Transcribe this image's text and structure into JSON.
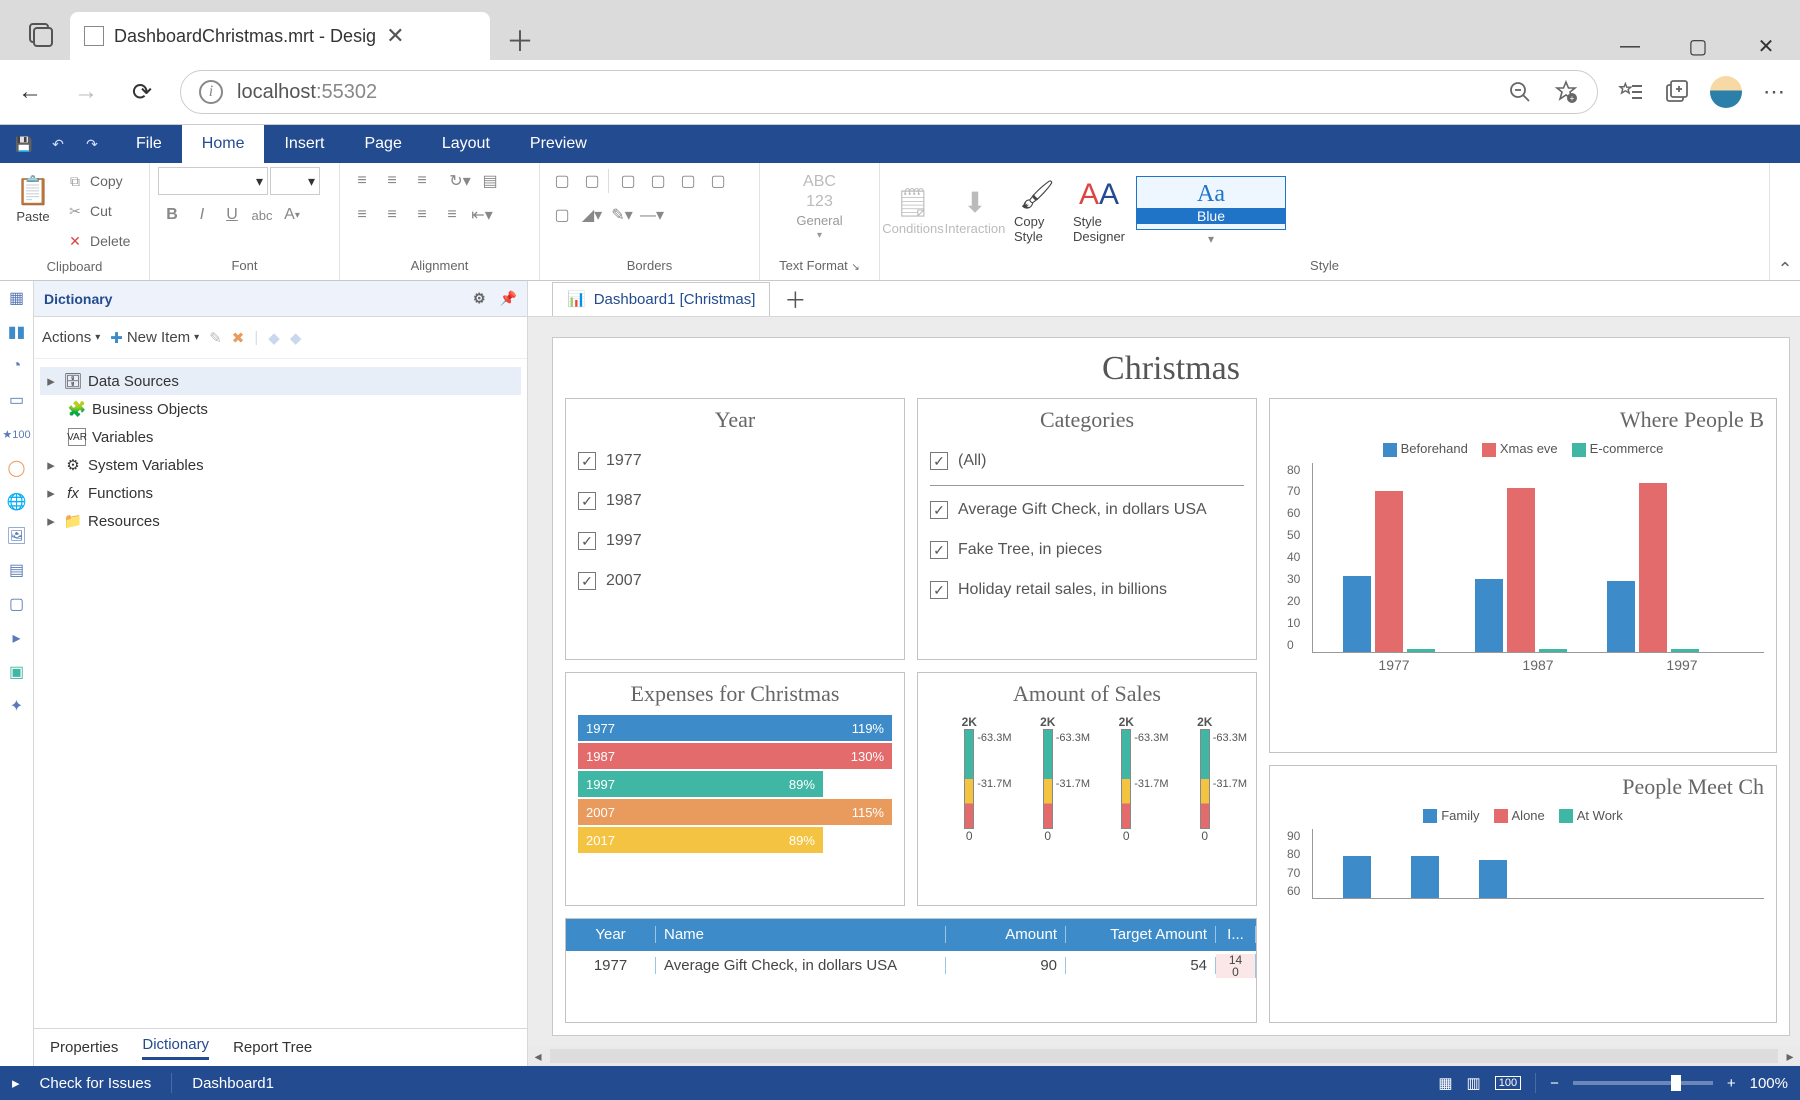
{
  "browser": {
    "tab_title": "DashboardChristmas.mrt - Desig",
    "host": "localhost",
    "port": ":55302"
  },
  "ribbon": {
    "tabs": [
      "File",
      "Home",
      "Insert",
      "Page",
      "Layout",
      "Preview"
    ],
    "active_tab": "Home",
    "clipboard": {
      "paste": "Paste",
      "copy": "Copy",
      "cut": "Cut",
      "delete": "Delete",
      "group": "Clipboard"
    },
    "font": {
      "group": "Font"
    },
    "alignment": {
      "group": "Alignment"
    },
    "borders": {
      "group": "Borders"
    },
    "textformat": {
      "abc": "ABC",
      "num": "123",
      "general": "General",
      "group": "Text Format"
    },
    "style": {
      "conditions": "Conditions",
      "interaction": "Interaction",
      "copystyle": "Copy Style",
      "designer": "Style Designer",
      "swatch_aa": "Aa",
      "swatch_name": "Blue",
      "group": "Style"
    }
  },
  "dictionary": {
    "title": "Dictionary",
    "toolbar": {
      "actions": "Actions",
      "newitem": "New Item"
    },
    "tree": {
      "datasources": "Data Sources",
      "business": "Business Objects",
      "variables": "Variables",
      "sysvars": "System Variables",
      "functions": "Functions",
      "resources": "Resources"
    },
    "bottom_tabs": [
      "Properties",
      "Dictionary",
      "Report Tree"
    ],
    "bottom_active": "Dictionary"
  },
  "doc_tabs": {
    "tab1": "Dashboard1 [Christmas]"
  },
  "dashboard": {
    "title": "Christmas",
    "year_card": {
      "title": "Year",
      "items": [
        "1977",
        "1987",
        "1997",
        "2007"
      ]
    },
    "cat_card": {
      "title": "Categories",
      "all": "(All)",
      "items": [
        "Average Gift Check, in dollars USA",
        "Fake Tree, in pieces",
        "Holiday retail sales, in billions"
      ]
    },
    "expenses": {
      "title": "Expenses for Christmas",
      "rows": [
        {
          "label": "1977",
          "pct": "119%"
        },
        {
          "label": "1987",
          "pct": "130%"
        },
        {
          "label": "1997",
          "pct": "89%"
        },
        {
          "label": "2007",
          "pct": "115%"
        },
        {
          "label": "2017",
          "pct": "89%"
        }
      ]
    },
    "sales": {
      "title": "Amount of Sales",
      "cols": [
        "2K",
        "2K",
        "2K",
        "2K"
      ],
      "mid_label": "-63.3M",
      "low_label": "-31.7M",
      "bottom": "0"
    },
    "where": {
      "title": "Where People B",
      "legend": [
        "Beforehand",
        "Xmas eve",
        "E-commerce"
      ]
    },
    "meet": {
      "title": "People Meet Ch",
      "legend": [
        "Family",
        "Alone",
        "At Work"
      ]
    },
    "table": {
      "headers": [
        "Year",
        "Name",
        "Amount",
        "Target Amount",
        "I..."
      ],
      "row": {
        "year": "1977",
        "name": "Average Gift Check, in dollars USA",
        "amount": "90",
        "target": "54",
        "i": "14"
      },
      "row_i2": "0"
    }
  },
  "statusbar": {
    "check": "Check for Issues",
    "current": "Dashboard1",
    "zoom": "100%"
  },
  "chart_data": [
    {
      "type": "bar",
      "title": "Where People Buy (truncated)",
      "categories": [
        "1977",
        "1987",
        "1997"
      ],
      "series": [
        {
          "name": "Beforehand",
          "values": [
            32,
            31,
            30
          ]
        },
        {
          "name": "Xmas eve",
          "values": [
            68,
            69,
            71
          ]
        },
        {
          "name": "E-commerce",
          "values": [
            1,
            1,
            1
          ]
        }
      ],
      "ylim": [
        0,
        80
      ],
      "yticks": [
        0,
        10,
        20,
        30,
        40,
        50,
        60,
        70,
        80
      ]
    },
    {
      "type": "bar",
      "title": "People Meet Christmas (truncated)",
      "categories": [
        "",
        "",
        ""
      ],
      "series": [
        {
          "name": "Family",
          "values": [
            78,
            78,
            76
          ]
        },
        {
          "name": "Alone",
          "values": [
            null,
            null,
            null
          ]
        },
        {
          "name": "At Work",
          "values": [
            null,
            null,
            null
          ]
        }
      ],
      "ylim": [
        60,
        90
      ],
      "yticks": [
        60,
        70,
        80,
        90
      ]
    },
    {
      "type": "bar",
      "title": "Expenses for Christmas",
      "categories": [
        "1977",
        "1987",
        "1997",
        "2007",
        "2017"
      ],
      "values_pct": [
        119,
        130,
        89,
        115,
        89
      ]
    },
    {
      "type": "table",
      "headers": [
        "Year",
        "Name",
        "Amount",
        "Target Amount"
      ],
      "rows": [
        [
          "1977",
          "Average Gift Check, in dollars USA",
          90,
          54
        ]
      ]
    }
  ]
}
